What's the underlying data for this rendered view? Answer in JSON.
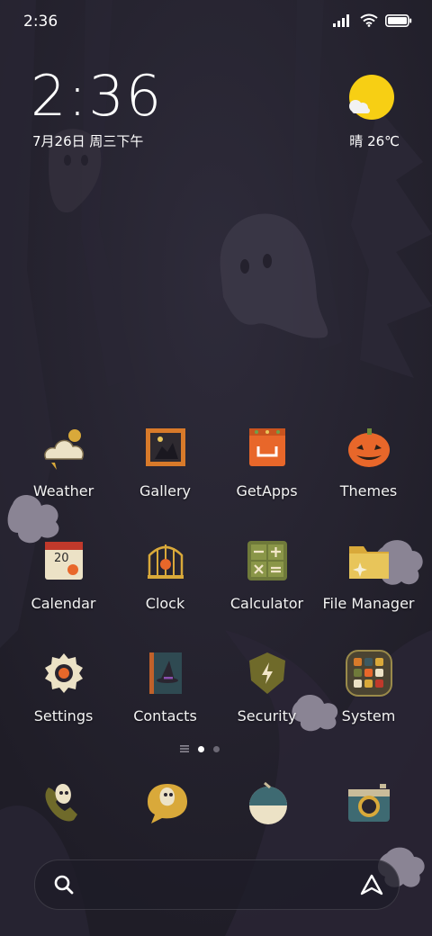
{
  "status_bar": {
    "time": "2:36"
  },
  "clock_widget": {
    "time": "2:36",
    "date": "7月26日 周三下午"
  },
  "weather_widget": {
    "condition": "晴",
    "temperature": "26℃"
  },
  "apps": [
    {
      "label": "Weather"
    },
    {
      "label": "Gallery"
    },
    {
      "label": "GetApps"
    },
    {
      "label": "Themes"
    },
    {
      "label": "Calendar"
    },
    {
      "label": "Clock"
    },
    {
      "label": "Calculator"
    },
    {
      "label": "File Manager"
    },
    {
      "label": "Settings"
    },
    {
      "label": "Contacts"
    },
    {
      "label": "Security"
    },
    {
      "label": "System"
    }
  ],
  "calendar_day": "20",
  "page_indicator": {
    "pages": 2,
    "current": 1
  },
  "dock": [
    "phone-icon",
    "messages-icon",
    "browser-icon",
    "camera-icon"
  ],
  "colors": {
    "background": "#24222e",
    "sun": "#f7cf14",
    "accent_orange": "#e8672a"
  }
}
